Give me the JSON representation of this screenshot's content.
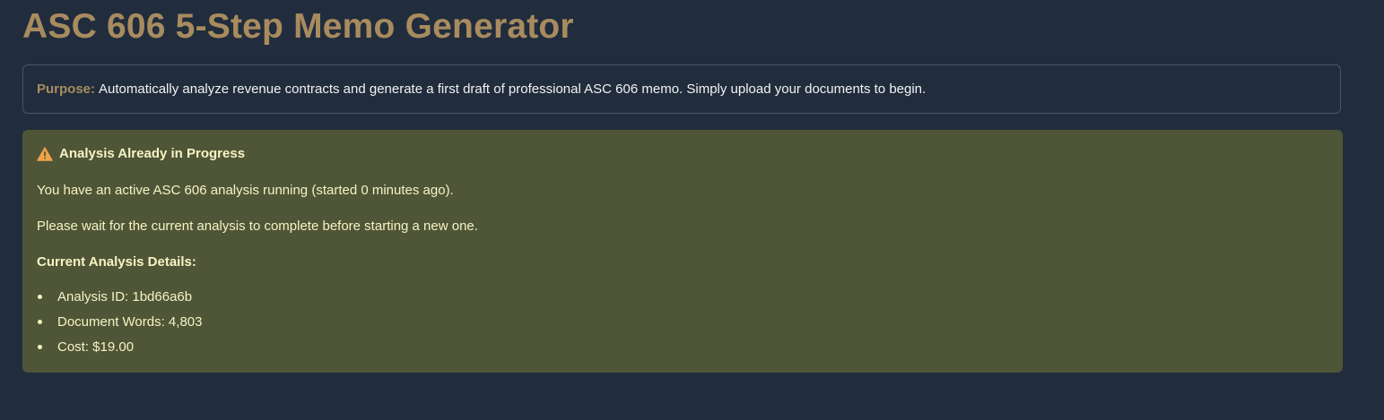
{
  "header": {
    "title": "ASC 606 5-Step Memo Generator"
  },
  "purpose": {
    "label": "Purpose:",
    "text": "Automatically analyze revenue contracts and generate a first draft of professional ASC 606 memo. Simply upload your documents to begin."
  },
  "warning": {
    "icon": "warning-icon",
    "heading": "Analysis Already in Progress",
    "status_line": "You have an active ASC 606 analysis running (started 0 minutes ago).",
    "instruction_line": "Please wait for the current analysis to complete before starting a new one.",
    "details_heading": "Current Analysis Details:",
    "details": [
      "Analysis ID: 1bd66a6b",
      "Document Words: 4,803",
      "Cost: $19.00"
    ]
  },
  "colors": {
    "background": "#212d3d",
    "title": "#a88b5e",
    "warning_bg": "#4f5537",
    "warning_text": "#f6f3c4",
    "warning_icon": "#f0a24a"
  }
}
